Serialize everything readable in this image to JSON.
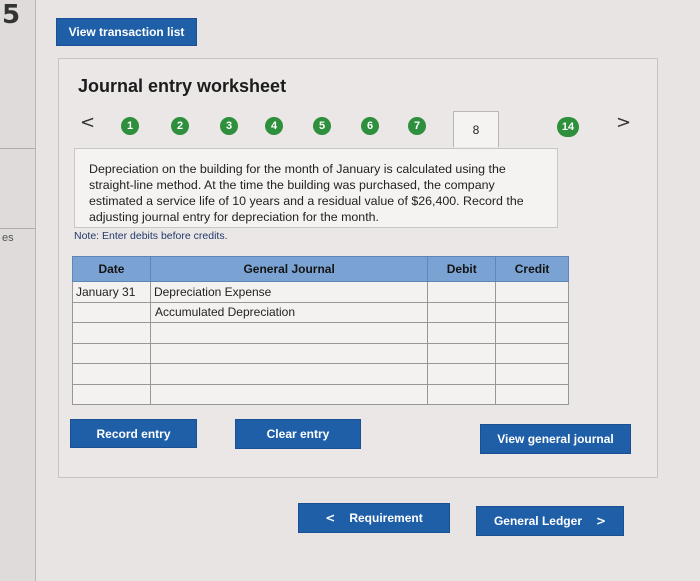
{
  "edge": {
    "top_mark": "5",
    "side_mark": "es"
  },
  "header": {
    "view_transactions_label": "View transaction list"
  },
  "worksheet": {
    "title": "Journal entry worksheet",
    "prev_arrow": "<",
    "next_arrow": ">",
    "steps": [
      "1",
      "2",
      "3",
      "4",
      "5",
      "6",
      "7",
      "8",
      "14"
    ],
    "current_step": "8",
    "step_color": "#2e8f3c",
    "description": "Depreciation on the building for the month of January is calculated using the straight-line method. At the time the building was purchased, the company estimated a service life of 10 years and a residual value of $26,400. Record the adjusting journal entry for depreciation for the month.",
    "note": "Note: Enter debits before credits."
  },
  "journal": {
    "headers": {
      "date": "Date",
      "general_journal": "General Journal",
      "debit": "Debit",
      "credit": "Credit"
    },
    "rows": [
      {
        "date": "January 31",
        "account": "Depreciation Expense",
        "debit": "",
        "credit": ""
      },
      {
        "date": "",
        "account": "Accumulated Depreciation",
        "debit": "",
        "credit": ""
      },
      {
        "date": "",
        "account": "",
        "debit": "",
        "credit": ""
      },
      {
        "date": "",
        "account": "",
        "debit": "",
        "credit": ""
      },
      {
        "date": "",
        "account": "",
        "debit": "",
        "credit": ""
      },
      {
        "date": "",
        "account": "",
        "debit": "",
        "credit": ""
      }
    ],
    "header_color": "#7aa3d4"
  },
  "actions": {
    "record_entry": "Record entry",
    "clear_entry": "Clear entry",
    "view_general_journal": "View general journal"
  },
  "footer_nav": {
    "requirement": "Requirement",
    "requirement_arrow": "<",
    "general_ledger": "General Ledger",
    "general_ledger_arrow": ">"
  },
  "accent_color": "#1f5fa8"
}
